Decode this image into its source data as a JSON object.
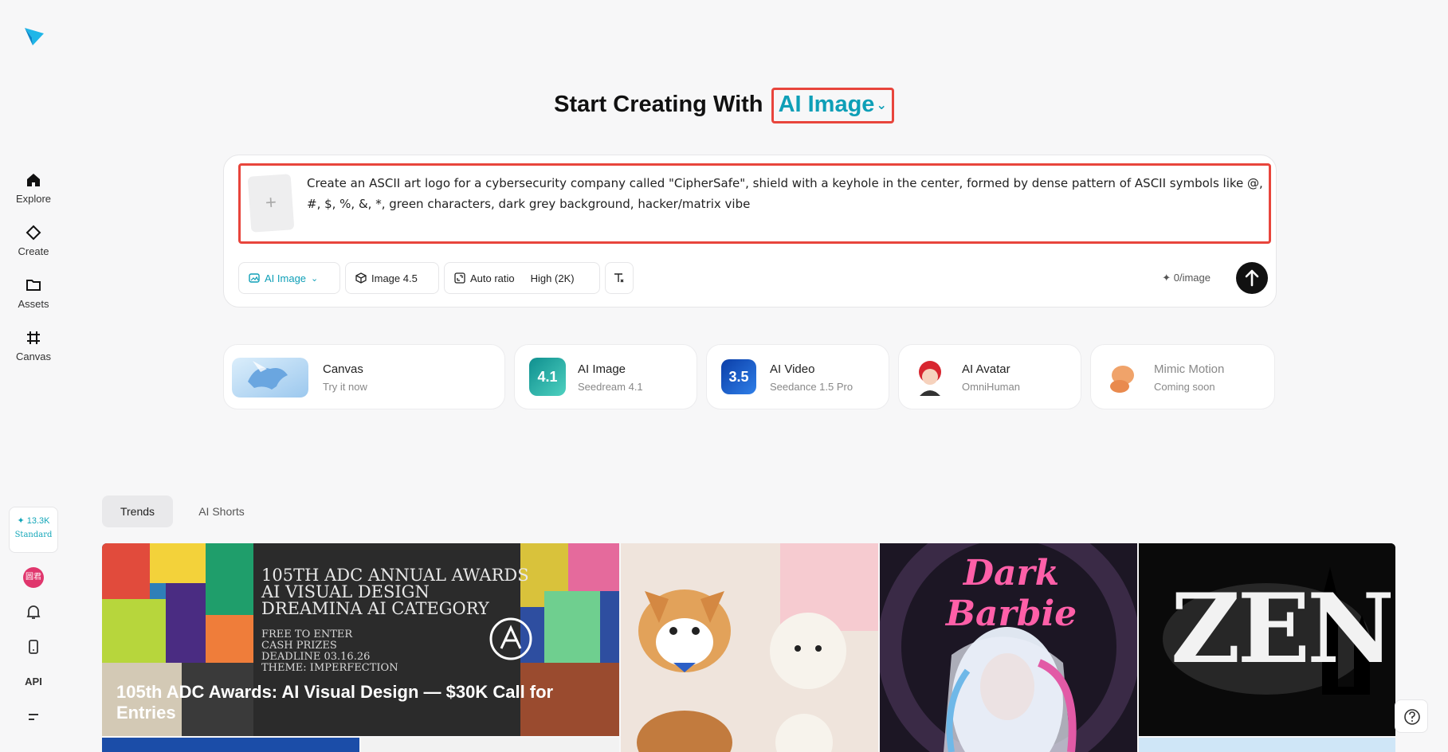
{
  "sidebar": {
    "items": [
      {
        "label": "Explore",
        "icon": "home-icon"
      },
      {
        "label": "Create",
        "icon": "diamond-icon"
      },
      {
        "label": "Assets",
        "icon": "folder-icon"
      },
      {
        "label": "Canvas",
        "icon": "canvas-icon"
      }
    ],
    "credits": {
      "amount": "13.3K",
      "tier": "Standard"
    },
    "avatar_text": "圆君",
    "api_label": "API"
  },
  "heading": {
    "prefix": "Start Creating With",
    "mode": "AI Image"
  },
  "prompt": {
    "text": "Create an ASCII art logo for a cybersecurity company called \"CipherSafe\", shield with a keyhole in the center, formed by dense pattern of ASCII symbols like @, #, $, %, &, *, green characters, dark grey background, hacker/matrix vibe",
    "upload_icon": "+"
  },
  "toolbar": {
    "mode_label": "AI Image",
    "model_label": "Image 4.5",
    "ratio_label": "Auto ratio",
    "quality_label": "High (2K)",
    "cost_label": "0/image"
  },
  "tools": [
    {
      "title": "Canvas",
      "sub": "Try it now"
    },
    {
      "title": "AI Image",
      "sub": "Seedream 4.1",
      "badge": "4.1"
    },
    {
      "title": "AI Video",
      "sub": "Seedance 1.5 Pro",
      "badge": "3.5"
    },
    {
      "title": "AI Avatar",
      "sub": "OmniHuman"
    },
    {
      "title": "Mimic Motion",
      "sub": "Coming soon"
    }
  ],
  "tabs": [
    "Trends",
    "AI Shorts"
  ],
  "gallery": {
    "featured_caption": "105th ADC Awards: AI Visual Design — $30K Call for Entries",
    "featured_lines": [
      "105TH ADC ANNUAL AWARDS",
      "AI VISUAL DESIGN",
      "DREAMINA AI CATEGORY"
    ],
    "featured_small": [
      "FREE TO ENTER",
      "CASH PRIZES",
      "DEADLINE 03.16.26",
      "THEME: IMPERFECTION"
    ],
    "barbie_title": "Dark Barbie",
    "zen_title": "ZEN"
  },
  "colors": {
    "accent": "#0e9fb7",
    "highlight": "#e8453c"
  }
}
